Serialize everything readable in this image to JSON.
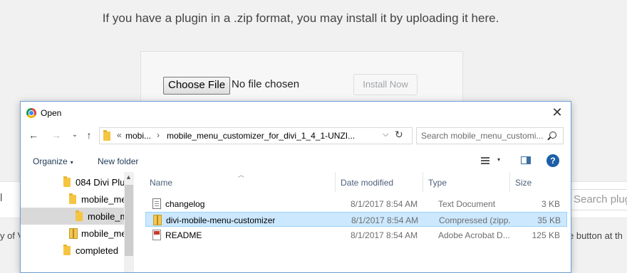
{
  "wp_page": {
    "intro_text": "If you have a plugin in a .zip format, you may install it by uploading it here.",
    "choose_file_label": "Choose File",
    "no_file_text": "No file chosen",
    "install_now_label": "Install Now",
    "search_plugins_placeholder": "Search plug",
    "row_left_text": "y of V",
    "row_right_text": "e button at th",
    "bar_left_char": "l"
  },
  "dialog": {
    "title": "Open",
    "close_glyph": "✕",
    "nav": {
      "back": "←",
      "forward": "→",
      "recent": "⌄",
      "up": "↑"
    },
    "breadcrumbs": [
      "«",
      "mobi...",
      "›",
      "mobile_menu_customizer_for_divi_1_4_1-UNZI..."
    ],
    "address_dropdown": "⌵",
    "refresh": "↻",
    "search_placeholder": "Search mobile_menu_customi...",
    "toolbar": {
      "organize_label": "Organize",
      "organize_caret": "▾",
      "new_folder_label": "New folder",
      "view_caret": "▾",
      "help_label": "?"
    },
    "tree": [
      {
        "label": "084 Divi Plu",
        "icon": "folder-icon"
      },
      {
        "label": "mobile_me",
        "icon": "folder-icon"
      },
      {
        "label": "mobile_m",
        "icon": "folder-icon",
        "selected": true
      },
      {
        "label": "mobile_me",
        "icon": "zip-folder-icon"
      },
      {
        "label": "completed",
        "icon": "folder-icon"
      }
    ],
    "columns": {
      "name": "Name",
      "date": "Date modified",
      "type": "Type",
      "size": "Size"
    },
    "files": [
      {
        "name": "changelog",
        "date": "8/1/2017 8:54 AM",
        "type": "Text Document",
        "size": "3 KB",
        "icon": "text-file-icon"
      },
      {
        "name": "divi-mobile-menu-customizer",
        "date": "8/1/2017 8:54 AM",
        "type": "Compressed (zipp...",
        "size": "35 KB",
        "icon": "zip-file-icon",
        "selected": true
      },
      {
        "name": "README",
        "date": "8/1/2017 8:54 AM",
        "type": "Adobe Acrobat D...",
        "size": "125 KB",
        "icon": "pdf-file-icon"
      }
    ]
  },
  "colors": {
    "selection_bg": "#cce8ff",
    "selection_border": "#99d1ff",
    "folder": "#f5c542",
    "help_blue": "#1c5fa8"
  }
}
